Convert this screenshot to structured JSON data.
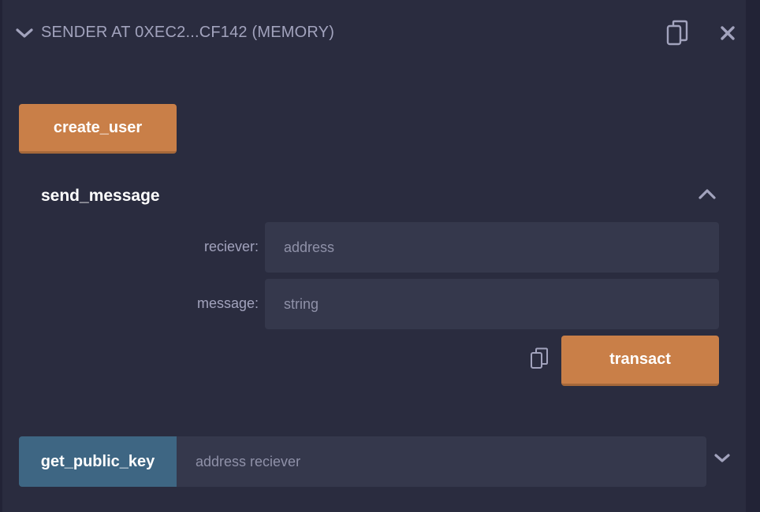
{
  "header": {
    "title": "SENDER AT 0XEC2...CF142 (MEMORY)",
    "toggle_icon": "chevron-down-icon",
    "copy_icon": "copy-icon",
    "close_icon": "close-icon"
  },
  "functions": {
    "create_user": {
      "label": "create_user"
    },
    "send_message": {
      "title": "send_message",
      "collapse_icon": "chevron-up-icon",
      "params": [
        {
          "label": "reciever:",
          "placeholder": "address"
        },
        {
          "label": "message:",
          "placeholder": "string"
        }
      ],
      "copy_icon": "copy-icon",
      "transact_label": "transact"
    },
    "get_public_key": {
      "label": "get_public_key",
      "placeholder": "address reciever",
      "expand_icon": "chevron-down-icon"
    }
  },
  "colors": {
    "background": "#2a2c3f",
    "transact_button": "#c97f48",
    "call_button": "#3e6683",
    "input": "#35384c",
    "muted_text": "#a2a3bd"
  }
}
